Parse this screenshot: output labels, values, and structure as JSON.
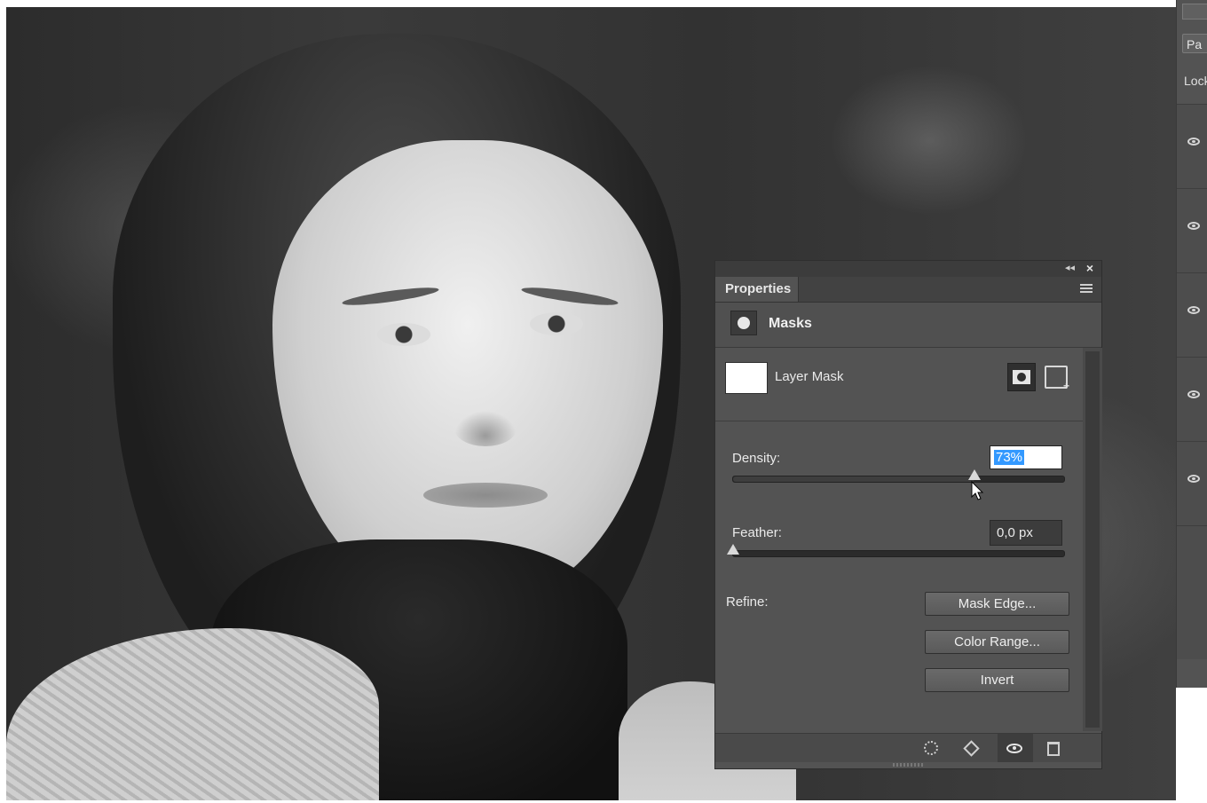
{
  "photo": {
    "subject": "portrait"
  },
  "layers_panel": {
    "tab_label": "Pa",
    "lock_label": "Lock"
  },
  "properties_panel": {
    "tab_label": "Properties",
    "section_title": "Masks",
    "layer_name": "Layer Mask",
    "density": {
      "label": "Density:",
      "value": "73%",
      "percent": 73
    },
    "feather": {
      "label": "Feather:",
      "value": "0,0 px",
      "percent": 0
    },
    "refine": {
      "label": "Refine:",
      "buttons": [
        "Mask Edge...",
        "Color Range...",
        "Invert"
      ]
    }
  },
  "colors": {
    "panel_bg": "#535353",
    "selection_highlight": "#3399ff"
  },
  "icons": [
    "collapse-icon",
    "close-icon",
    "panel-menu-icon",
    "mask-icon",
    "pixel-mask-icon",
    "vector-mask-icon",
    "load-selection-icon",
    "apply-mask-icon",
    "visibility-icon",
    "delete-icon"
  ]
}
